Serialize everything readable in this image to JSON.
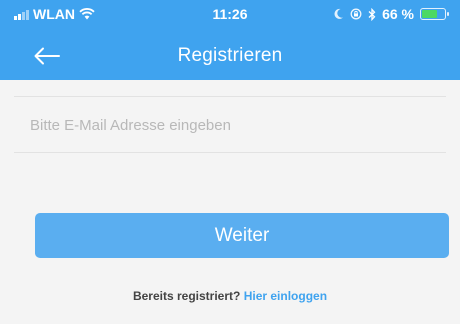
{
  "status_bar": {
    "carrier": "WLAN",
    "time": "11:26",
    "battery_percent": "66 %",
    "battery_level": 0.66,
    "icons": [
      "signal-icon",
      "wifi-icon",
      "moon-icon",
      "lock-rotation-icon",
      "bluetooth-icon",
      "battery-icon"
    ]
  },
  "header": {
    "title": "Registrieren",
    "back_icon": "arrow-left-icon",
    "background_color": "#3fa3ef"
  },
  "form": {
    "email_placeholder": "Bitte E-Mail Adresse eingeben",
    "email_value": ""
  },
  "actions": {
    "continue_label": "Weiter",
    "button_color": "#5aaef0"
  },
  "footer": {
    "already_registered": "Bereits registriert?",
    "login_link": "Hier einloggen"
  }
}
